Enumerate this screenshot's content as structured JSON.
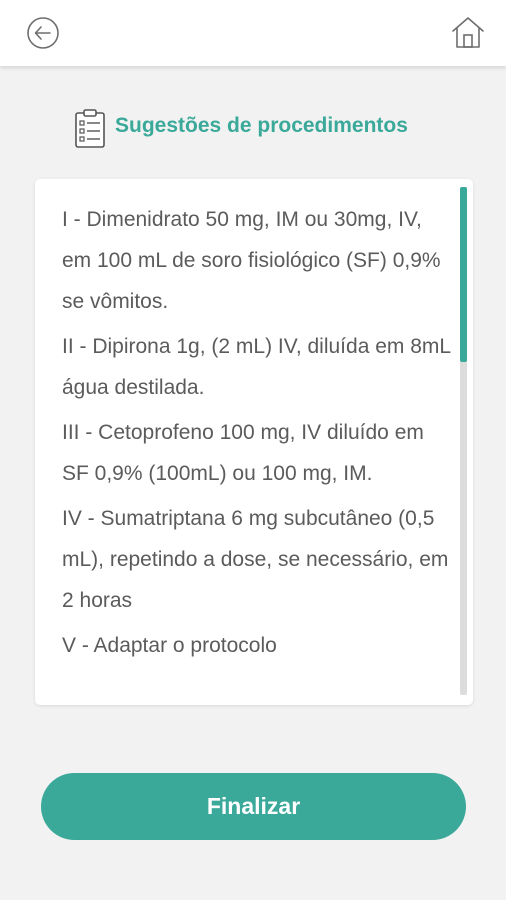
{
  "header": {
    "back_icon": "arrow-left-circle-icon",
    "home_icon": "home-icon"
  },
  "section": {
    "icon": "clipboard-icon",
    "title": "Sugestões de procedimentos"
  },
  "procedures": [
    "I - Dimenidrato 50 mg, IM ou 30mg, IV, em 100 mL de soro fisiológico (SF) 0,9% se vômitos.",
    "II - Dipirona 1g, (2 mL) IV, diluída em 8mL água destilada.",
    "III - Cetoprofeno 100 mg, IV diluído em SF 0,9% (100mL) ou 100 mg, IM.",
    "IV - Sumatriptana 6 mg subcutâneo (0,5 mL), repetindo a dose, se necessário, em 2 horas",
    "V - Adaptar o protocolo"
  ],
  "actions": {
    "finalize_label": "Finalizar"
  },
  "colors": {
    "accent": "#3aa99a",
    "text": "#5b5b5b",
    "background": "#f2f2f2"
  }
}
